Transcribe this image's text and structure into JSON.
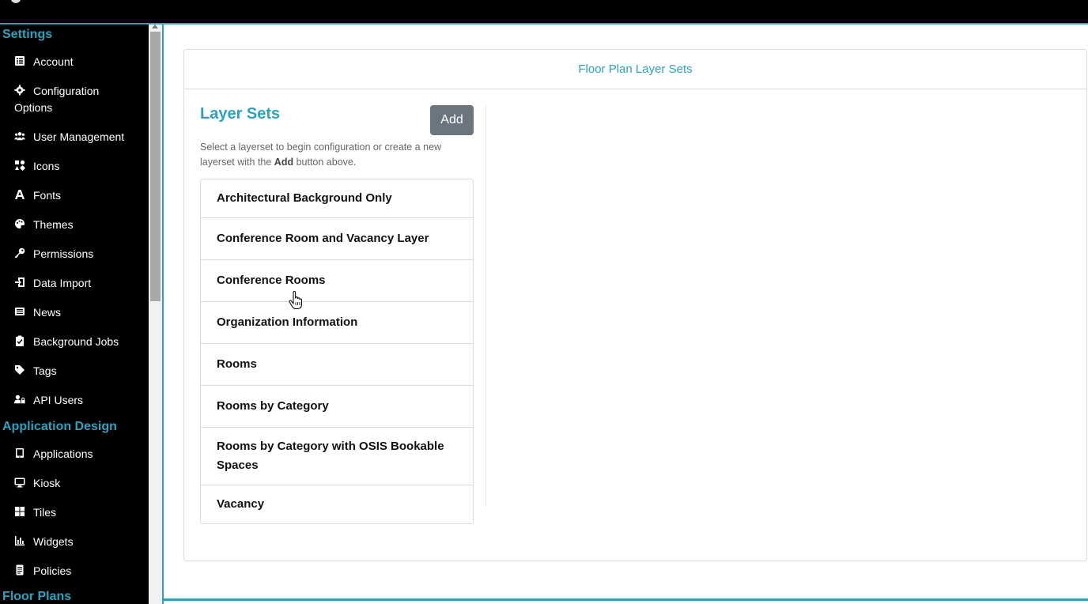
{
  "sidebar": {
    "sections": [
      {
        "title": "Settings",
        "items": [
          {
            "label": "Account",
            "icon": "list-icon"
          },
          {
            "label": "Configuration Options",
            "icon": "gear-icon"
          },
          {
            "label": "User Management",
            "icon": "users-icon"
          },
          {
            "label": "Icons",
            "icon": "icons-icon"
          },
          {
            "label": "Fonts",
            "icon": "font-icon"
          },
          {
            "label": "Themes",
            "icon": "palette-icon"
          },
          {
            "label": "Permissions",
            "icon": "key-icon"
          },
          {
            "label": "Data Import",
            "icon": "import-icon"
          },
          {
            "label": "News",
            "icon": "news-icon"
          },
          {
            "label": "Background Jobs",
            "icon": "clipboard-check-icon"
          },
          {
            "label": "Tags",
            "icon": "tag-icon"
          },
          {
            "label": "API Users",
            "icon": "user-lock-icon"
          }
        ]
      },
      {
        "title": "Application Design",
        "items": [
          {
            "label": "Applications",
            "icon": "tablet-icon"
          },
          {
            "label": "Kiosk",
            "icon": "desktop-icon"
          },
          {
            "label": "Tiles",
            "icon": "tiles-icon"
          },
          {
            "label": "Widgets",
            "icon": "chart-icon"
          },
          {
            "label": "Policies",
            "icon": "document-icon"
          }
        ]
      },
      {
        "title": "Floor Plans",
        "items": []
      }
    ]
  },
  "main": {
    "card_title": "Floor Plan Layer Sets",
    "layer_sets_title": "Layer Sets",
    "add_label": "Add",
    "help_text_before": "Select a layerset to begin configuration or create a new layerset with the ",
    "help_text_bold": "Add",
    "help_text_after": " button above.",
    "layer_sets": [
      "Architectural Background Only",
      "Conference Room and Vacancy Layer",
      "Conference Rooms",
      "Organization Information",
      "Rooms",
      "Rooms by Category",
      "Rooms by Category with OSIS Bookable Spaces",
      "Vacancy"
    ]
  },
  "colors": {
    "accent": "#2aa3c0",
    "sidebar_bg": "#000000",
    "button_bg": "#6c757d"
  }
}
